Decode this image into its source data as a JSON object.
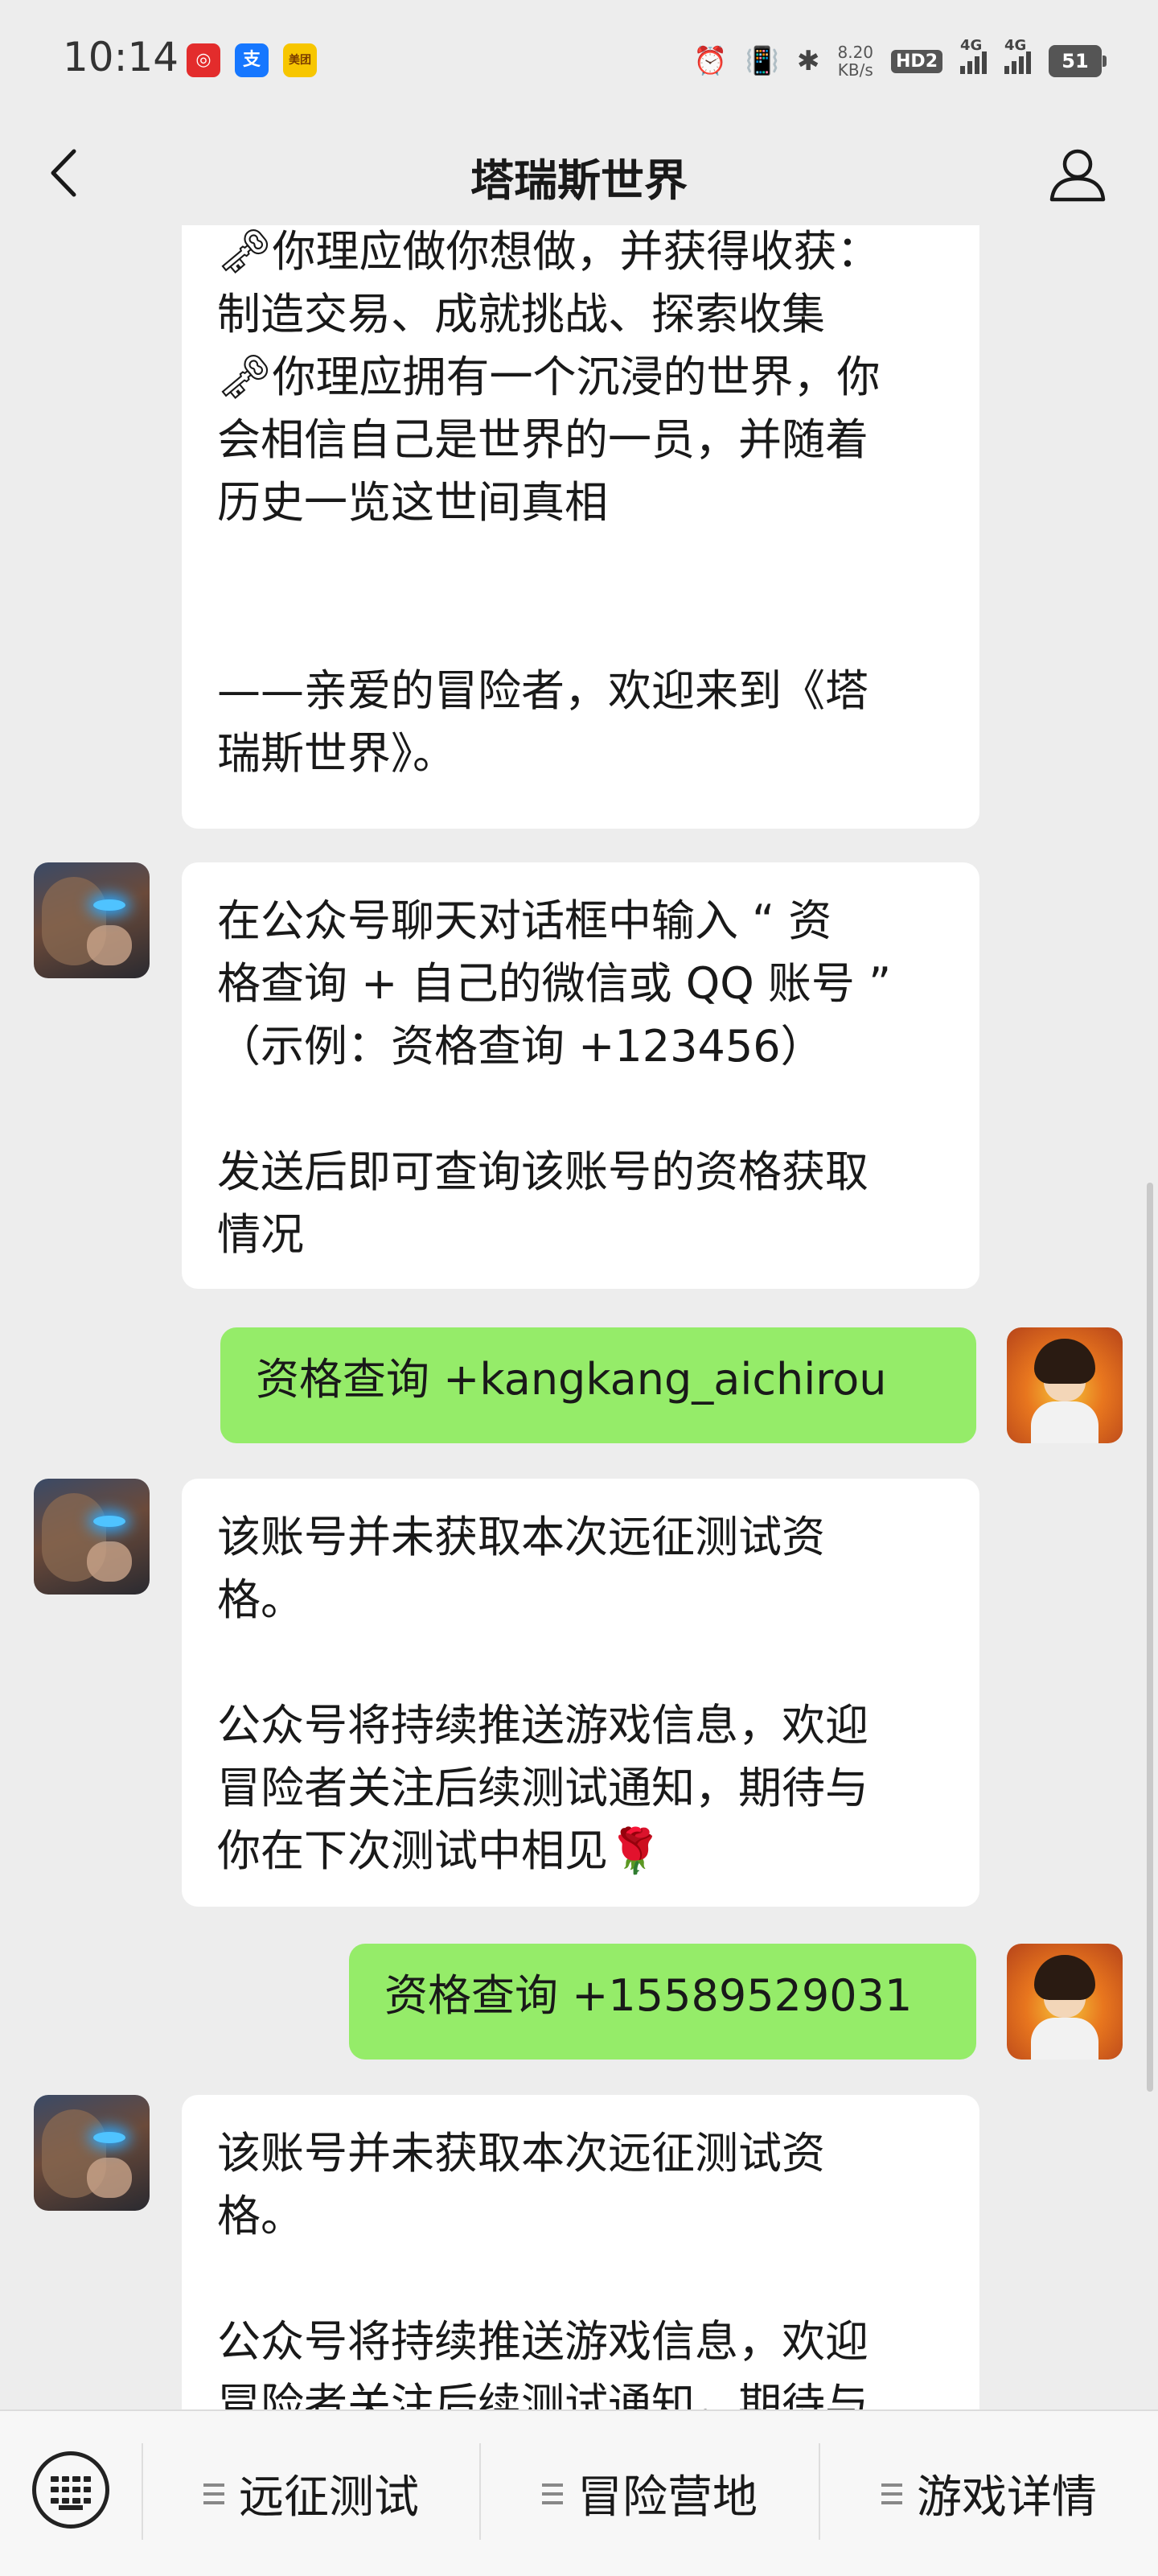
{
  "status_bar": {
    "time": "10:14",
    "app_badges": [
      {
        "name": "netease-music-icon",
        "text": "◎",
        "color": "#e32c2c"
      },
      {
        "name": "alipay-icon",
        "text": "支",
        "color": "#1677ff"
      },
      {
        "name": "meituan-icon",
        "text": "美团",
        "color": "#f7c600"
      }
    ],
    "net_speed_value": "8.20",
    "net_speed_unit": "KB/s",
    "hd_label": "HD2",
    "signal1_label": "4G",
    "signal2_label": "4G",
    "battery": "51"
  },
  "nav": {
    "title": "塔瑞斯世界"
  },
  "messages": [
    {
      "id": "m1",
      "direction": "received",
      "show_avatar": false,
      "text": "🗝你理应做你想做，并获得收获：\n制造交易、成就挑战、探索收集\n🗝你理应拥有一个沉浸的世界，你\n会相信自己是世界的一员，并随着\n历史一览这世间真相\n\n\n——亲爱的冒险者，欢迎来到《塔\n瑞斯世界》。"
    },
    {
      "id": "m2",
      "direction": "received",
      "show_avatar": true,
      "text": "在公众号聊天对话框中输入 “ 资\n格查询 + 自己的微信或 QQ 账号 ”\n（示例：资格查询 +123456）\n\n发送后即可查询该账号的资格获取\n情况"
    },
    {
      "id": "m3",
      "direction": "sent",
      "show_avatar": true,
      "text": "资格查询 +kangkang_aichirou"
    },
    {
      "id": "m4",
      "direction": "received",
      "show_avatar": true,
      "text": "该账号并未获取本次远征测试资\n格。\n\n公众号将持续推送游戏信息，欢迎\n冒险者关注后续测试通知，期待与\n你在下次测试中相见🌹"
    },
    {
      "id": "m5",
      "direction": "sent",
      "show_avatar": true,
      "text": "资格查询 +15589529031"
    },
    {
      "id": "m6",
      "direction": "received",
      "show_avatar": true,
      "text": "该账号并未获取本次远征测试资\n格。\n\n公众号将持续推送游戏信息，欢迎\n冒险者关注后续测试通知，期待与"
    }
  ],
  "menu": {
    "items": [
      "远征测试",
      "冒险营地",
      "游戏详情"
    ]
  },
  "colors": {
    "background": "#ededed",
    "received_bubble": "#ffffff",
    "sent_bubble": "#95ec69",
    "menu_bar": "#f7f7f7"
  }
}
